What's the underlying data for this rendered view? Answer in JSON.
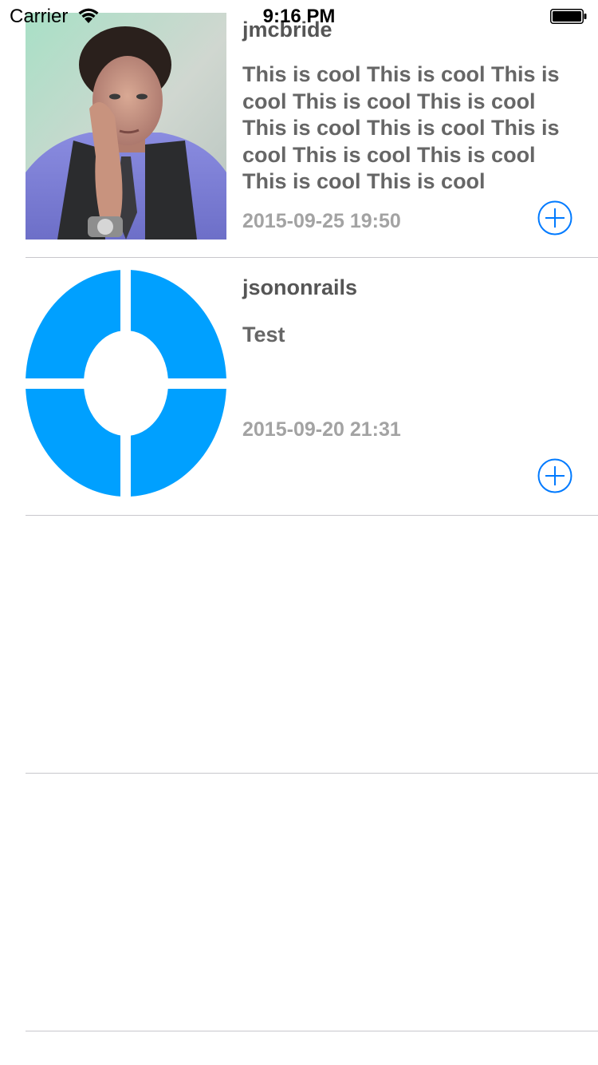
{
  "status_bar": {
    "carrier": "Carrier",
    "time": "9:16 PM",
    "wifi_icon": "wifi-icon",
    "battery_icon": "battery-icon"
  },
  "posts": [
    {
      "username": "jmcbride",
      "message": "This is cool This is cool This is cool This is cool This is cool This is cool This is cool This is cool This is cool This is cool This is cool This is cool",
      "timestamp": "2015-09-25 19:50",
      "avatar": "user-photo-avatar",
      "action_icon": "add-circle-icon"
    },
    {
      "username": "jsononrails",
      "message": "Test",
      "timestamp": "2015-09-20 21:31",
      "avatar": "blue-ring-logo-avatar",
      "action_icon": "add-circle-icon"
    }
  ],
  "colors": {
    "accent": "#007aff",
    "logo_blue": "#00a0ff",
    "separator": "#c8c7cc",
    "username": "#555555",
    "message": "#666666",
    "timestamp": "#a3a3a3"
  }
}
